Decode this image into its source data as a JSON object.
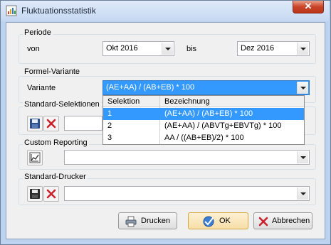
{
  "window": {
    "title": "Fluktuationsstatistik",
    "close_symbol": "✕"
  },
  "periode": {
    "group_label": "Periode",
    "von_label": "von",
    "von_value": "Okt 2016",
    "bis_label": "bis",
    "bis_value": "Dez 2016"
  },
  "formel": {
    "group_label": "Formel-Variante",
    "variante_label": "Variante",
    "selected_value": "(AE+AA) / (AB+EB) * 100",
    "dropdown": {
      "headers": [
        "Selektion",
        "Bezeichnung"
      ],
      "rows": [
        {
          "sel": "1",
          "bez": "(AE+AA) / (AB+EB) * 100"
        },
        {
          "sel": "2",
          "bez": "(AE+AA) / (ABVTg+EBVTg) * 100"
        },
        {
          "sel": "3",
          "bez": "AA / ((AB+EB)/2) * 100"
        }
      ]
    }
  },
  "standard_selektionen": {
    "group_label": "Standard-Selektionen",
    "value": ""
  },
  "custom_reporting": {
    "group_label": "Custom Reporting",
    "value": ""
  },
  "standard_drucker": {
    "group_label": "Standard-Drucker",
    "value": ""
  },
  "buttons": {
    "drucken": "Drucken",
    "ok": "OK",
    "abbrechen": "Abbrechen"
  },
  "colors": {
    "selection": "#3399ff",
    "dropdown_highlight": "#3399ff"
  }
}
